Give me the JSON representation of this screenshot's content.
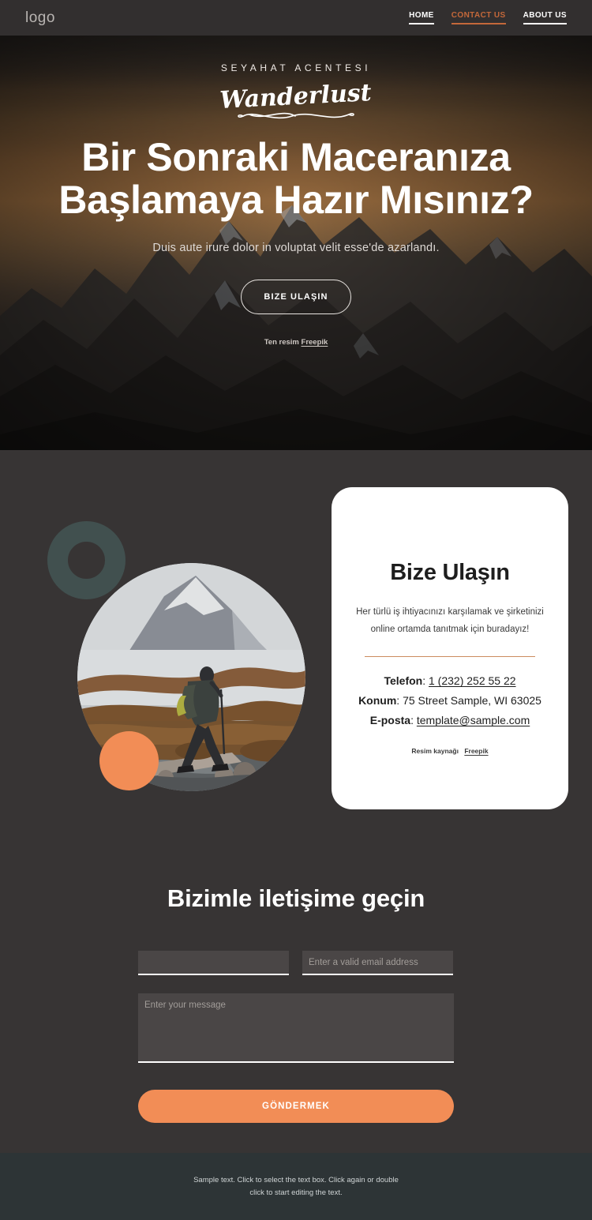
{
  "header": {
    "logo": "logo",
    "nav": [
      {
        "label": "HOME",
        "accent": false
      },
      {
        "label": "CONTACT US",
        "accent": true
      },
      {
        "label": "ABOUT US",
        "accent": false
      }
    ]
  },
  "hero": {
    "eyebrow": "SEYAHAT ACENTESI",
    "script_logo": "Wanderlust",
    "title": "Bir Sonraki Maceranıza Başlamaya Hazır Mısınız?",
    "subtitle": "Duis aute irure dolor in voluptat velit esse'de azarlandı.",
    "cta_label": "BIZE ULAŞIN",
    "credit_prefix": "Ten resim",
    "credit_link": "Freepik"
  },
  "contact_card": {
    "title": "Bize Ulaşın",
    "description": "Her türlü iş ihtiyacınızı karşılamak ve şirketinizi online ortamda tanıtmak için buradayız!",
    "rows": [
      {
        "label": "Telefon",
        "value": "1 (232) 252 55 22",
        "link": true
      },
      {
        "label": "Konum",
        "value": "75 Street Sample, WI 63025",
        "link": false
      },
      {
        "label": "E-posta",
        "value": "template@sample.com",
        "link": true
      }
    ],
    "credit_prefix": "Resim kaynağı",
    "credit_link": "Freepik"
  },
  "form": {
    "title": "Bizimle iletişime geçin",
    "name_value": "",
    "name_placeholder": "",
    "email_value": "",
    "email_placeholder": "Enter a valid email address",
    "message_value": "",
    "message_placeholder": "Enter your message",
    "submit_label": "GÖNDERMEK"
  },
  "footer": {
    "line1": "Sample text. Click to select the text box. Click again or double",
    "line2": "click to start editing the text."
  },
  "colors": {
    "accent_orange": "#f28d56",
    "nav_accent": "#c4683a",
    "teal_ring": "#41504f",
    "page_dark": "#373434",
    "header_dark": "#322f2f",
    "footer_dark": "#2d3436",
    "card_white": "#ffffff",
    "divider_tan": "#cc8c5f"
  }
}
